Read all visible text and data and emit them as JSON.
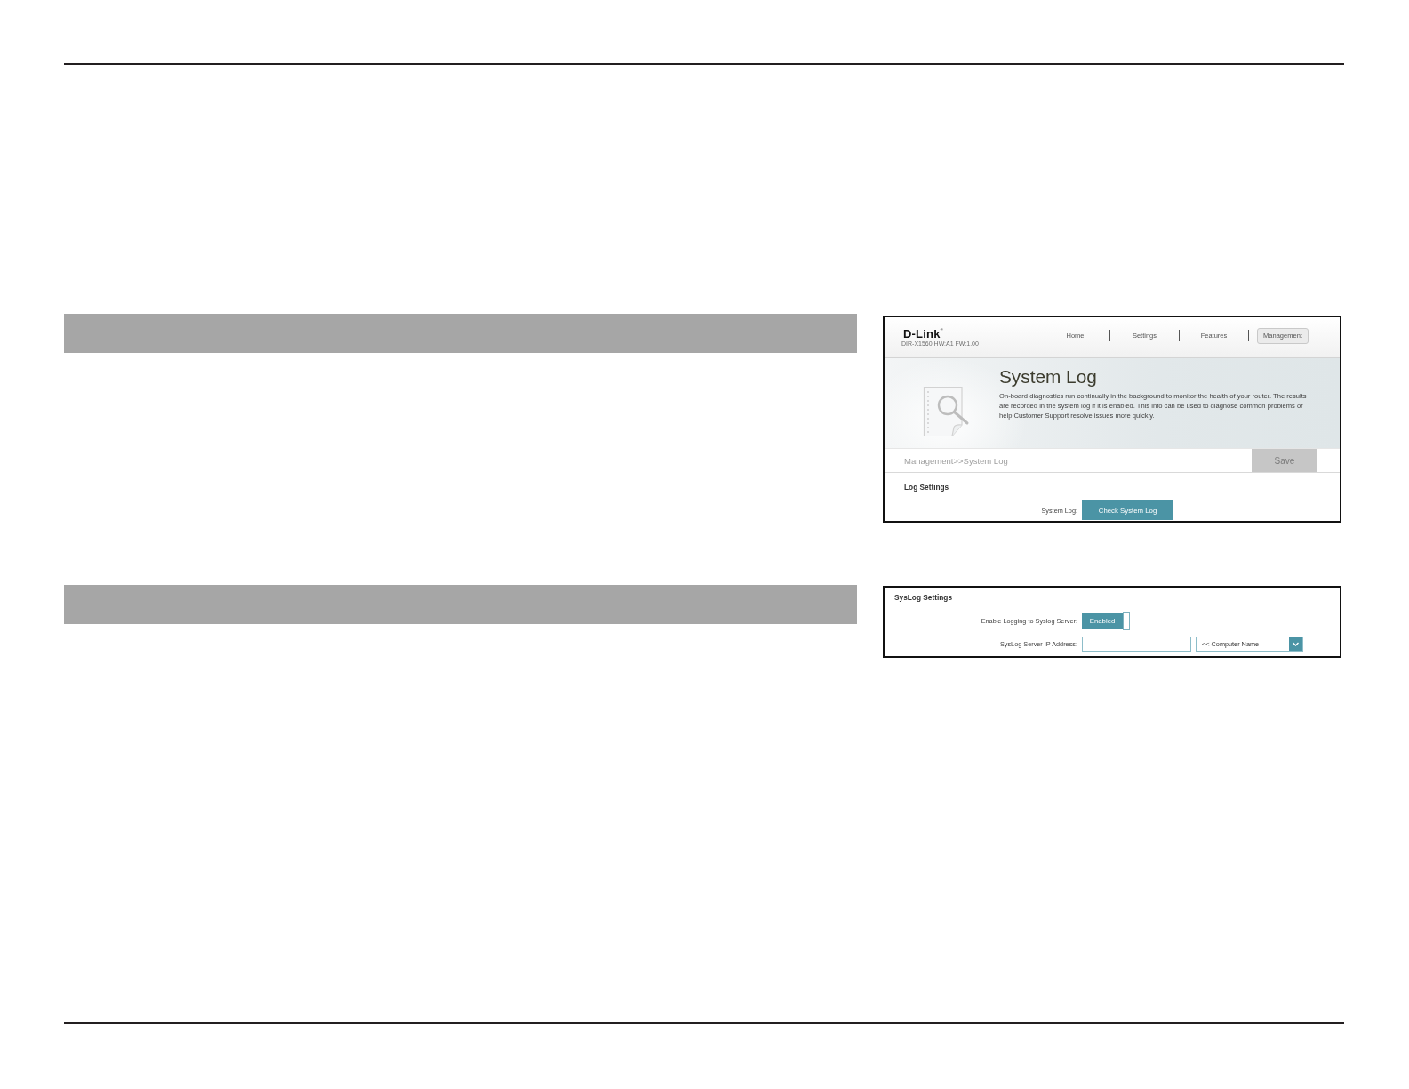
{
  "router_page": {
    "logo": "D-Link$^{®}$",
    "model_info": "DIR-X1560 HW:A1 FW:1.00",
    "nav_items": [
      {
        "label": "Home",
        "selected": false
      },
      {
        "label": "Settings",
        "selected": false
      },
      {
        "label": "Features",
        "selected": false
      },
      {
        "label": "Management",
        "selected": true
      }
    ],
    "banner": {
      "title": "System Log",
      "description": "On-board diagnostics run continually in the background to monitor the health of your router. The results are recorded in the system log if it is enabled. This info can be used to diagnose common problems or help Customer Support resolve issues more quickly."
    },
    "breadcrumb": "Management>>System Log",
    "save_button": {
      "label": "Save",
      "disabled": true
    },
    "log_settings": {
      "heading": "Log Settings",
      "fields": [
        {
          "kind": "button",
          "label": "System Log:",
          "button": "Check System Log"
        }
      ]
    }
  },
  "syslog_panel": {
    "heading": "SysLog Settings",
    "fields": [
      {
        "kind": "toggle",
        "label": "Enable Logging to Syslog Server:",
        "value": "Enabled",
        "on": true
      },
      {
        "kind": "address",
        "label": "SysLog Server IP Address:",
        "select": "<< Computer Name"
      }
    ]
  }
}
